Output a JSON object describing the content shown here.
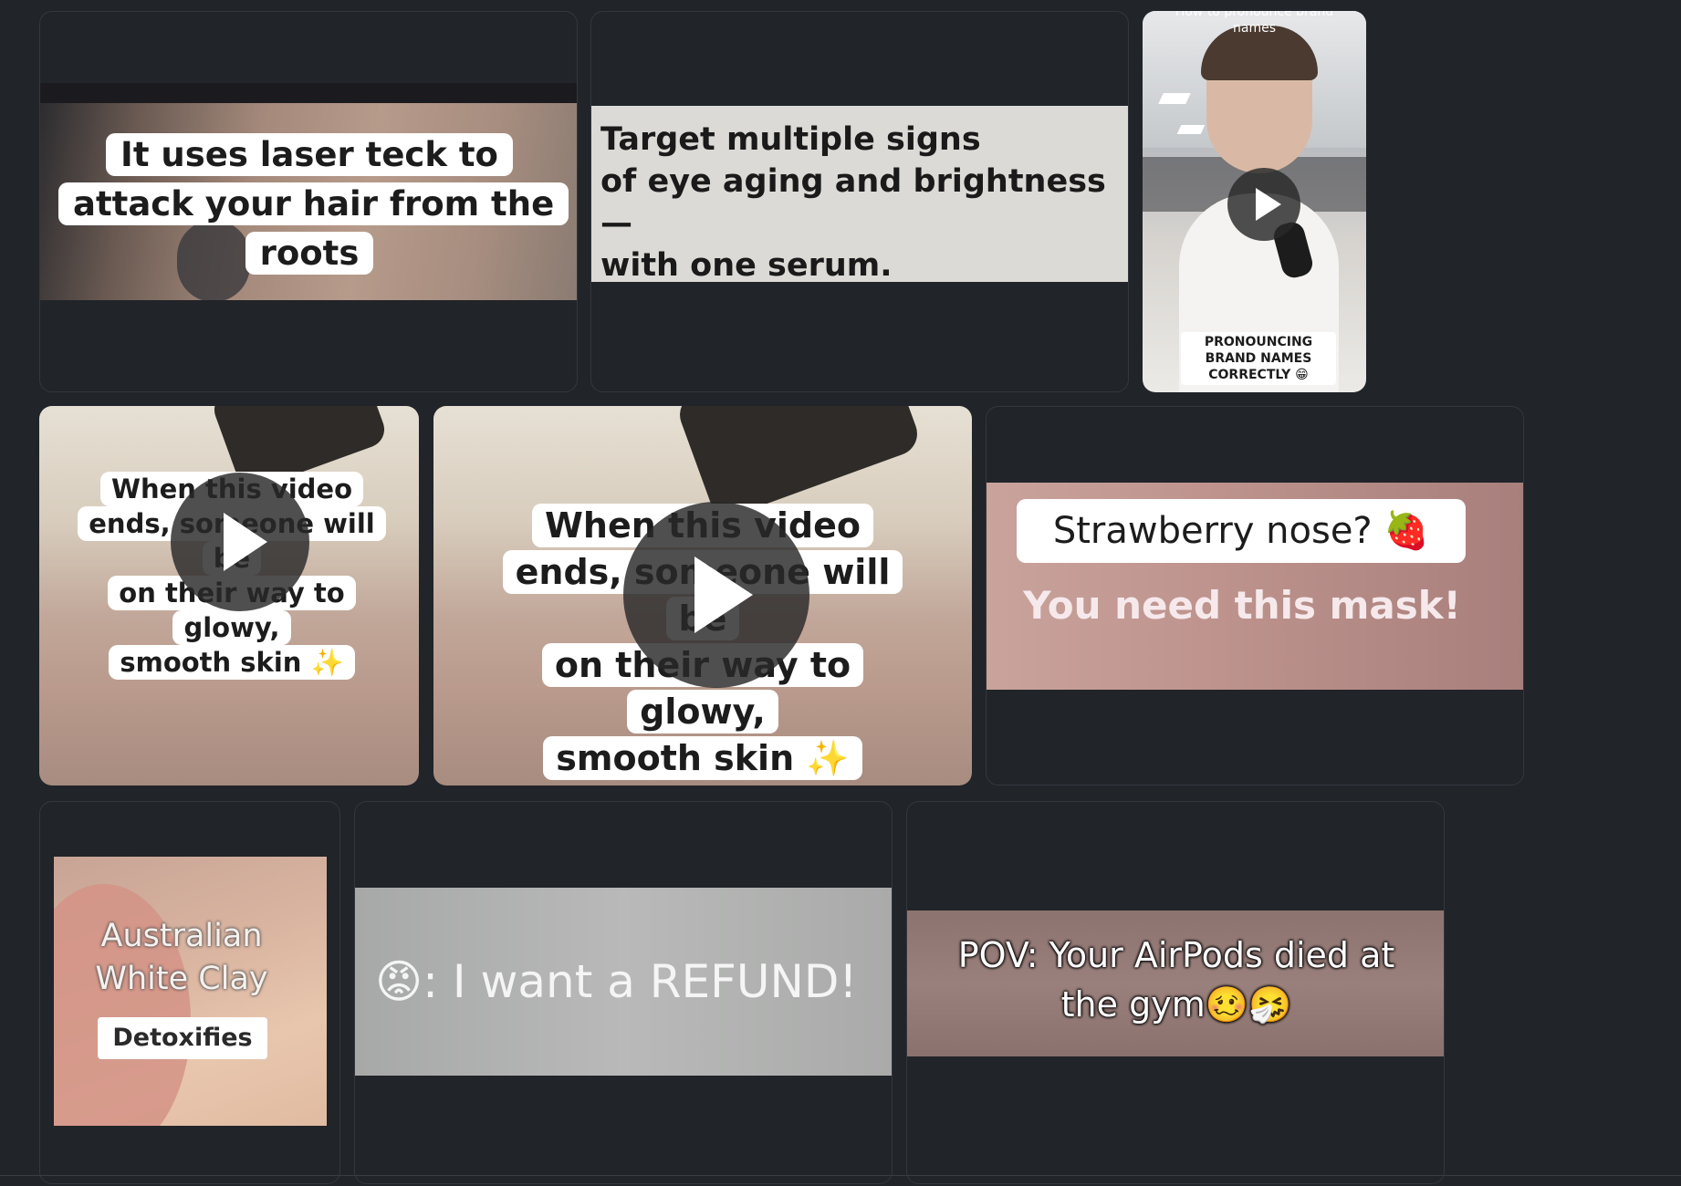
{
  "colors": {
    "page_bg": "#212429",
    "card_border": "#34383e",
    "play_overlay": "#282828",
    "pink_text": "#d98ba8"
  },
  "cards": {
    "c1": {
      "caption_lines": [
        "It uses laser teck to",
        "attack your hair from the",
        "roots"
      ]
    },
    "c2": {
      "caption_lines": [
        "Target multiple signs",
        "of eye aging and brightness—",
        "with one serum."
      ]
    },
    "c3": {
      "top_text": "How to pronounce brand names",
      "caption": "PRONOUNCING BRAND NAMES CORRECTLY 😁",
      "has_play_icon": true
    },
    "c4": {
      "caption_lines": [
        "When this video",
        "ends, someone will be",
        "on their way to glowy,",
        "smooth skin ✨"
      ],
      "has_play_icon": true
    },
    "c5": {
      "caption_lines": [
        "When this video",
        "ends, someone will be",
        "on their way to glowy,",
        "smooth skin ✨"
      ],
      "has_play_icon": true
    },
    "c6": {
      "caption_top": "Strawberry nose? 🍓",
      "caption_bottom": "You need this mask!"
    },
    "c7": {
      "caption_lines": [
        "Australian",
        "White Clay"
      ],
      "badge": "Detoxifies"
    },
    "c8": {
      "emoji": "😡",
      "caption": ": I want a REFUND!"
    },
    "c9": {
      "caption_lines": [
        "POV: Your AirPods died at",
        "the gym🥴🤧"
      ]
    }
  }
}
